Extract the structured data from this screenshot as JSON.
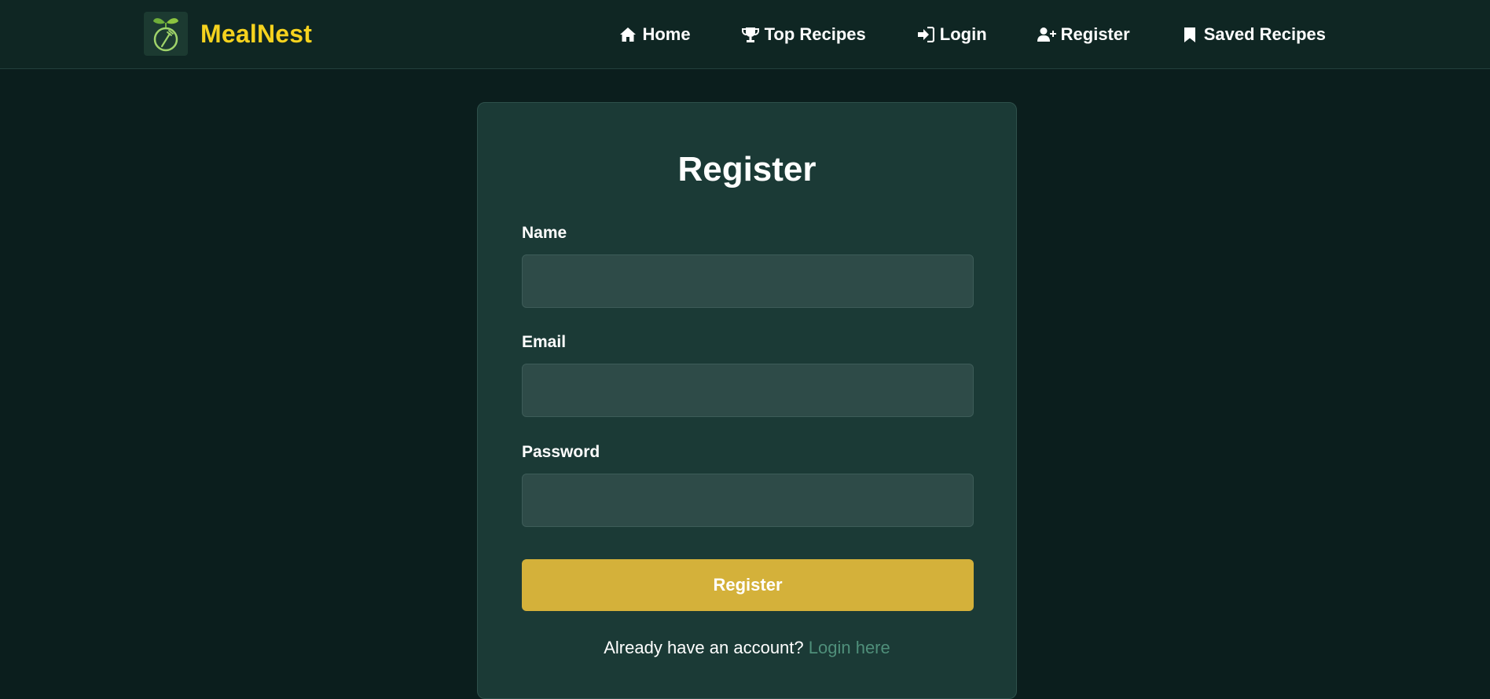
{
  "brand": {
    "name": "MealNest",
    "color": "#f5d21e"
  },
  "nav": {
    "items": [
      {
        "label": "Home",
        "icon": "home-icon"
      },
      {
        "label": "Top Recipes",
        "icon": "trophy-icon"
      },
      {
        "label": "Login",
        "icon": "sign-in-icon"
      },
      {
        "label": "Register",
        "icon": "user-plus-icon"
      },
      {
        "label": "Saved Recipes",
        "icon": "bookmark-icon"
      }
    ]
  },
  "form": {
    "title": "Register",
    "fields": [
      {
        "label": "Name",
        "value": "",
        "type": "text"
      },
      {
        "label": "Email",
        "value": "",
        "type": "email"
      },
      {
        "label": "Password",
        "value": "",
        "type": "password"
      }
    ],
    "submit_label": "Register",
    "footer_text": "Already have an account?",
    "footer_link": "Login here"
  },
  "colors": {
    "background": "#0b1e1d",
    "navbar": "#0f2623",
    "card": "#1b3a36",
    "input": "#2e4b48",
    "button": "#d4b13a",
    "link": "#4f8f7a"
  }
}
